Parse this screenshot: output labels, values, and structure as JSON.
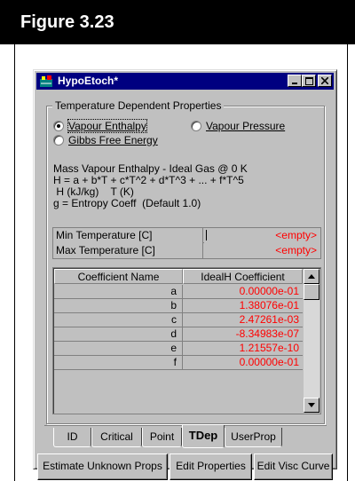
{
  "figure": {
    "title": "Figure 3.23"
  },
  "window": {
    "title": "HypoEtoch*"
  },
  "group": {
    "label": "Temperature Dependent Properties"
  },
  "radios": [
    {
      "label": "Vapour Enthalpy",
      "checked": true
    },
    {
      "label": "Vapour Pressure",
      "checked": false
    },
    {
      "label": "Gibbs Free Energy",
      "checked": false
    }
  ],
  "description": [
    "Mass Vapour Enthalpy - Ideal Gas @ 0 K",
    "H = a + b*T + c*T^2 + d*T^3 + ... + f*T^5",
    " H (kJ/kg)    T (K)",
    "g = Entropy Coeff  (Default 1.0)"
  ],
  "temps": [
    {
      "label": "Min Temperature [C]",
      "value": "<empty>"
    },
    {
      "label": "Max Temperature [C]",
      "value": "<empty>"
    }
  ],
  "grid": {
    "headers": [
      "Coefficient Name",
      "IdealH Coefficient"
    ],
    "rows": [
      {
        "name": "a",
        "value": "0.00000e-01"
      },
      {
        "name": "b",
        "value": "1.38076e-01"
      },
      {
        "name": "c",
        "value": "2.47261e-03"
      },
      {
        "name": "d",
        "value": "-8.34983e-07"
      },
      {
        "name": "e",
        "value": "1.21557e-10"
      },
      {
        "name": "f",
        "value": "0.00000e-01"
      }
    ]
  },
  "tabs": [
    {
      "label": "ID",
      "active": false
    },
    {
      "label": "Critical",
      "active": false
    },
    {
      "label": "Point",
      "active": false
    },
    {
      "label": "TDep",
      "active": true
    },
    {
      "label": "UserProp",
      "active": false
    }
  ],
  "buttons": [
    "Estimate Unknown Props",
    "Edit Properties",
    "Edit Visc Curve"
  ],
  "colors": {
    "titlebar": "#000080",
    "value_text": "#ff0000",
    "face": "#c0c0c0"
  }
}
